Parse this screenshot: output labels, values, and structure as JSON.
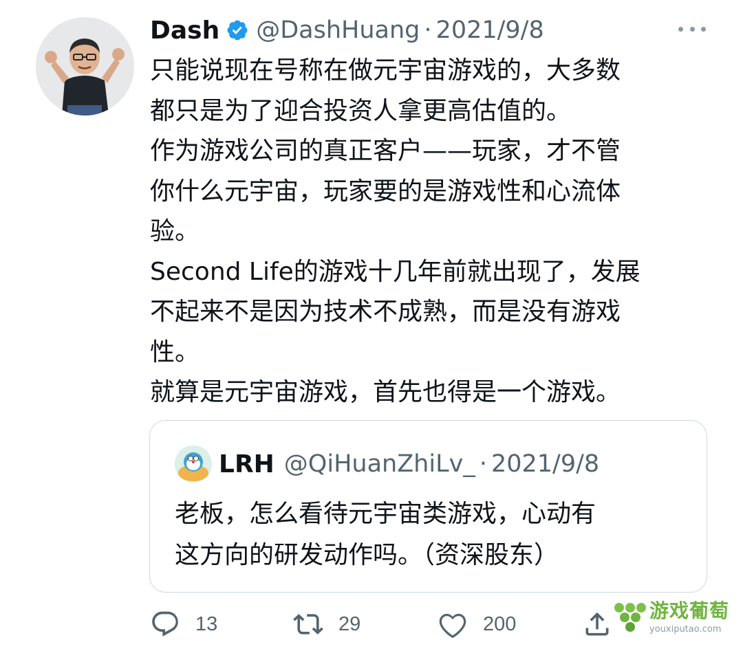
{
  "tweet": {
    "author_name": "Dash",
    "author_handle": "@DashHuang",
    "separator": "·",
    "date": "2021/9/8",
    "lines": [
      "只能说现在号称在做元宇宙游戏的，大多数",
      "都只是为了迎合投资人拿更高估值的。",
      "作为游戏公司的真正客户——玩家，才不管",
      "你什么元宇宙，玩家要的是游戏性和心流体",
      "验。",
      "Second Life的游戏十几年前就出现了，发展",
      "不起来不是因为技术不成熟，而是没有游戏",
      "性。",
      "就算是元宇宙游戏，首先也得是一个游戏。"
    ]
  },
  "quoted_tweet": {
    "author_name": "LRH",
    "author_handle": "@QiHuanZhiLv_",
    "separator": "·",
    "date": "2021/9/8",
    "lines": [
      "老板，怎么看待元宇宙类游戏，心动有",
      "这方向的研发动作吗。（资深股东）"
    ]
  },
  "actions": {
    "reply_count": "13",
    "retweet_count": "29",
    "like_count": "200"
  },
  "watermark": {
    "cn": "游戏葡萄",
    "en": "youxiputao.com"
  },
  "colors": {
    "text": "#0f1419",
    "secondary": "#536471",
    "verified": "#1d9bf0",
    "border": "#cfd9de",
    "watermark_green": "#6fb43f"
  }
}
